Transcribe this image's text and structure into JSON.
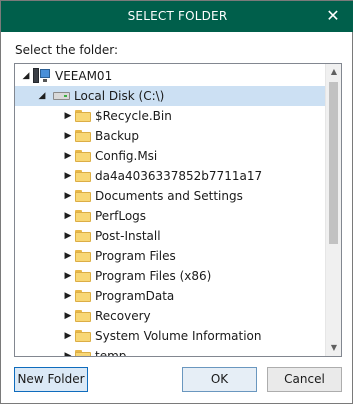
{
  "window": {
    "title": "SELECT FOLDER",
    "close_glyph": "✕"
  },
  "prompt": "Select the folder:",
  "tree": {
    "rows": [
      {
        "label": "VEEAM01",
        "icon": "computer-icon",
        "expander": "expanded"
      },
      {
        "label": "Local Disk (C:\\)",
        "icon": "disk-icon",
        "expander": "expanded",
        "selected": true
      },
      {
        "label": "$Recycle.Bin",
        "icon": "folder-icon",
        "expander": "collapsed"
      },
      {
        "label": "Backup",
        "icon": "folder-icon",
        "expander": "collapsed"
      },
      {
        "label": "Config.Msi",
        "icon": "folder-icon",
        "expander": "collapsed"
      },
      {
        "label": "da4a4036337852b7711a17",
        "icon": "folder-icon",
        "expander": "collapsed"
      },
      {
        "label": "Documents and Settings",
        "icon": "folder-icon",
        "expander": "collapsed"
      },
      {
        "label": "PerfLogs",
        "icon": "folder-icon",
        "expander": "collapsed"
      },
      {
        "label": "Post-Install",
        "icon": "folder-icon",
        "expander": "collapsed"
      },
      {
        "label": "Program Files",
        "icon": "folder-icon",
        "expander": "collapsed"
      },
      {
        "label": "Program Files (x86)",
        "icon": "folder-icon",
        "expander": "collapsed"
      },
      {
        "label": "ProgramData",
        "icon": "folder-icon",
        "expander": "collapsed"
      },
      {
        "label": "Recovery",
        "icon": "folder-icon",
        "expander": "collapsed"
      },
      {
        "label": "System Volume Information",
        "icon": "folder-icon",
        "expander": "collapsed"
      },
      {
        "label": "temp",
        "icon": "folder-icon",
        "expander": "collapsed"
      }
    ]
  },
  "buttons": {
    "new_folder": "New Folder",
    "ok": "OK",
    "cancel": "Cancel"
  },
  "colors": {
    "titlebar": "#005f4b",
    "selection": "#cce0f3",
    "folder": "#f8d775"
  }
}
